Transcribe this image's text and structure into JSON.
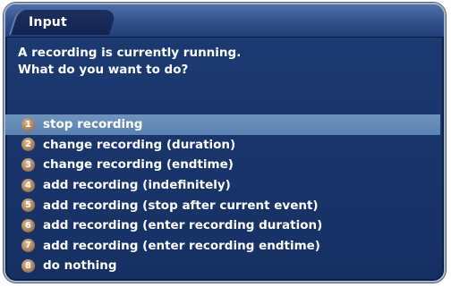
{
  "dialog": {
    "title": "Input",
    "message": "A recording is currently running.\nWhat do you want to do?",
    "selected_index": 0,
    "options": [
      {
        "number": "1",
        "label": "stop recording"
      },
      {
        "number": "2",
        "label": "change recording (duration)"
      },
      {
        "number": "3",
        "label": "change recording (endtime)"
      },
      {
        "number": "4",
        "label": "add recording (indefinitely)"
      },
      {
        "number": "5",
        "label": "add recording (stop after current event)"
      },
      {
        "number": "6",
        "label": "add recording (enter recording duration)"
      },
      {
        "number": "7",
        "label": "add recording (enter recording endtime)"
      },
      {
        "number": "8",
        "label": "do nothing"
      }
    ]
  },
  "colors": {
    "dialog_background": "#1d3a73",
    "title_bar": "#36558f",
    "selection_highlight": "#6f93bd",
    "badge": "#a77e59",
    "text": "#ffffff"
  }
}
